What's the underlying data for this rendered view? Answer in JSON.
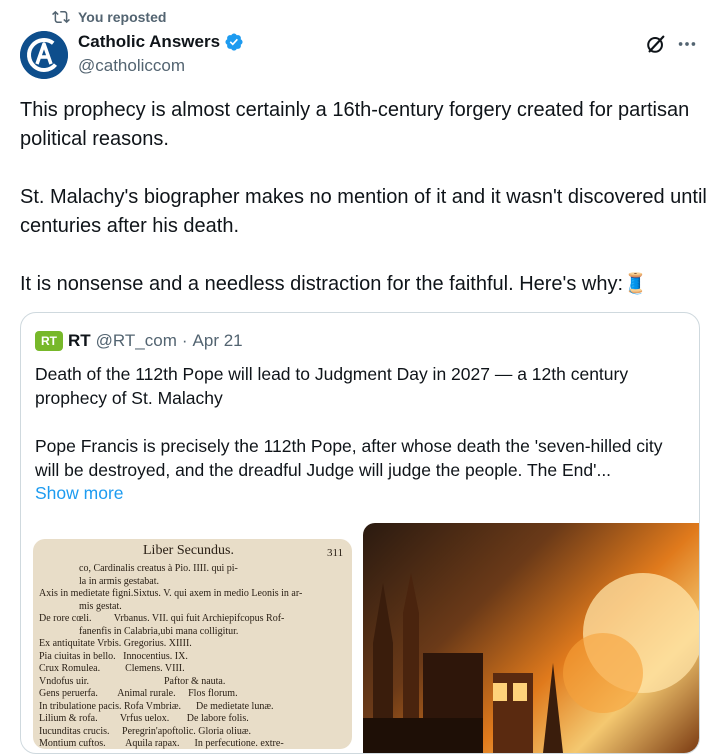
{
  "repost": {
    "label": "You reposted",
    "icon": "repost-icon"
  },
  "author": {
    "name": "Catholic Answers",
    "handle": "@catholiccom",
    "verified": true,
    "verified_color": "#1d9bf0"
  },
  "post": {
    "text": "This prophecy is almost certainly a 16th-century forgery created for partisan political reasons.\n\nSt. Malachy's biographer makes no mention of it and it wasn't discovered until centuries after his death.\n\nIt is nonsense and a needless distraction for the faithful. Here's why:",
    "emoji": "🧵"
  },
  "quote": {
    "logo": "RT",
    "name": "RT",
    "handle": "@RT_com",
    "separator": "·",
    "date": "Apr 21",
    "text": "Death of the 112th Pope will lead to Judgment Day in 2027 — a 12th century prophecy of St. Malachy\n\nPope Francis is precisely the 112th Pope, after whose death the 'seven-hilled city will be destroyed, and the dreadful Judge will judge the people. The End'...",
    "show_more": "Show more",
    "image_left": {
      "heading": "Liber Secundus.",
      "page_number": "311",
      "lines": [
        "                co, Cardinalis creatus à Pio. IIII. qui pi-",
        "                la in armis gestabat.",
        "Axis in medietate figni.Sixtus. V. qui axem in medio Leonis in ar-",
        "                mis gestat.",
        "De rore cœli.         Vrbanus. VII. qui fuit Archiepifcopus Rof-",
        "                fanenfis in Calabria,ubi mana colligitur.",
        "Ex antiquitate Vrbis. Gregorius. XIIII.",
        "Pia ciuitas in bello.   Innocentius. IX.",
        "Crux Romulea.          Clemens. VIII.",
        "Vndofus uir.                              Paftor & nauta.",
        "Gens peruerfa.        Animal rurale.     Flos florum.",
        "In tribulatione pacis. Rofa Vmbriæ.      De medietate lunæ.",
        "Lilium & rofa.         Vrfus uelox.       De labore folis.",
        "Iucunditas crucis.     Peregrin'apoftolic. Gloria oliuæ.",
        "Montium cuftos.        Aquila rapax.      In perfecutione. extre-"
      ]
    }
  }
}
